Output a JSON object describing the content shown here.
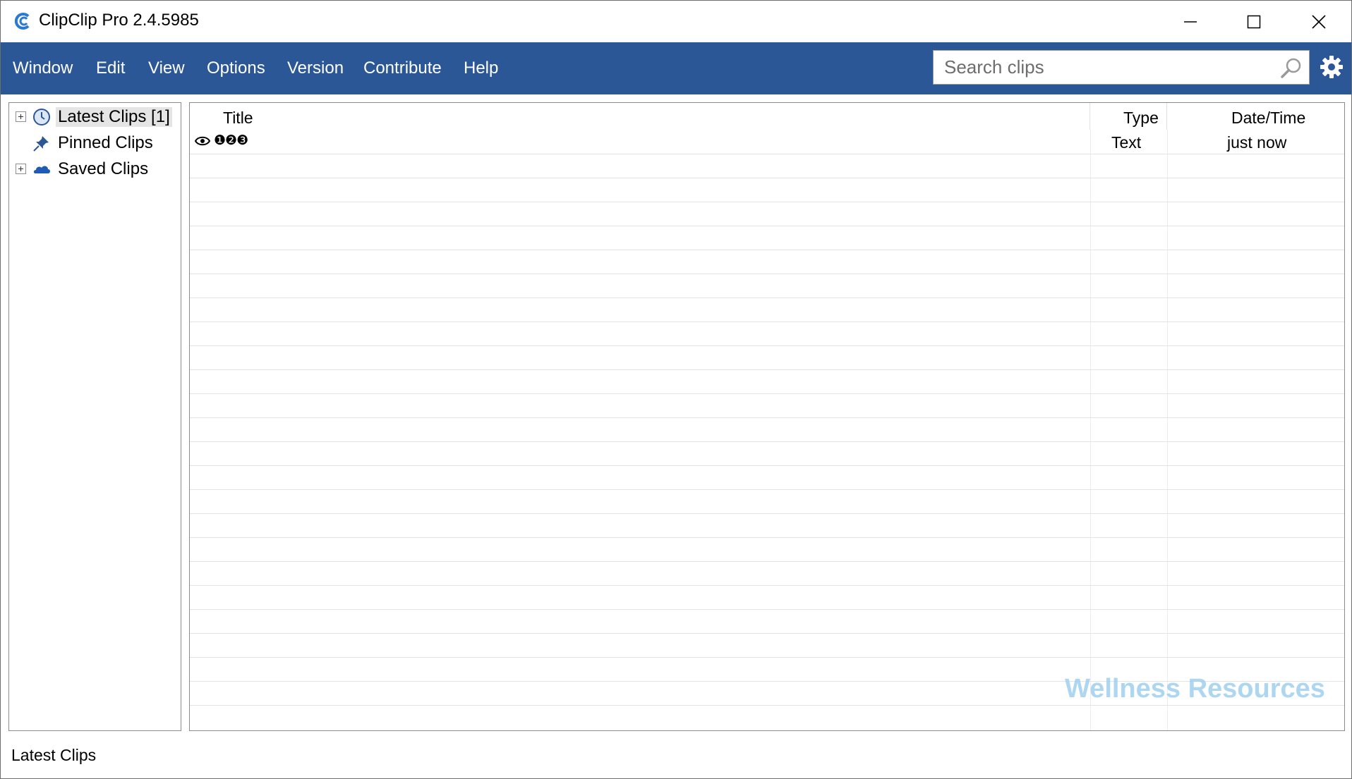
{
  "window": {
    "title": "ClipClip Pro 2.4.5985",
    "minimize_icon": "minimize-icon",
    "maximize_icon": "maximize-icon",
    "close_icon": "close-icon"
  },
  "menu": {
    "items": [
      {
        "label": "Window"
      },
      {
        "label": "Edit"
      },
      {
        "label": "View"
      },
      {
        "label": "Options"
      },
      {
        "label": "Version"
      },
      {
        "label": "Contribute"
      },
      {
        "label": "Help"
      }
    ],
    "bar_color": "#2b5797"
  },
  "search": {
    "placeholder": "Search clips",
    "value": "",
    "icon": "search-icon"
  },
  "settings": {
    "icon": "gear-icon"
  },
  "tree": {
    "items": [
      {
        "label": "Latest Clips [1]",
        "icon": "clock-icon",
        "expandable": true,
        "selected": true
      },
      {
        "label": "Pinned Clips",
        "icon": "pin-icon",
        "expandable": false,
        "selected": false
      },
      {
        "label": "Saved Clips",
        "icon": "cloud-icon",
        "expandable": true,
        "selected": false
      }
    ]
  },
  "grid": {
    "columns": [
      {
        "label": "Title"
      },
      {
        "label": "Type"
      },
      {
        "label": "Date/Time"
      }
    ],
    "rows": [
      {
        "preview_icon": "eye-icon",
        "title": "❶❷❸",
        "type": "Text",
        "datetime": "just now"
      }
    ]
  },
  "watermark": "Wellness Resources",
  "status": {
    "text": "Latest Clips"
  }
}
